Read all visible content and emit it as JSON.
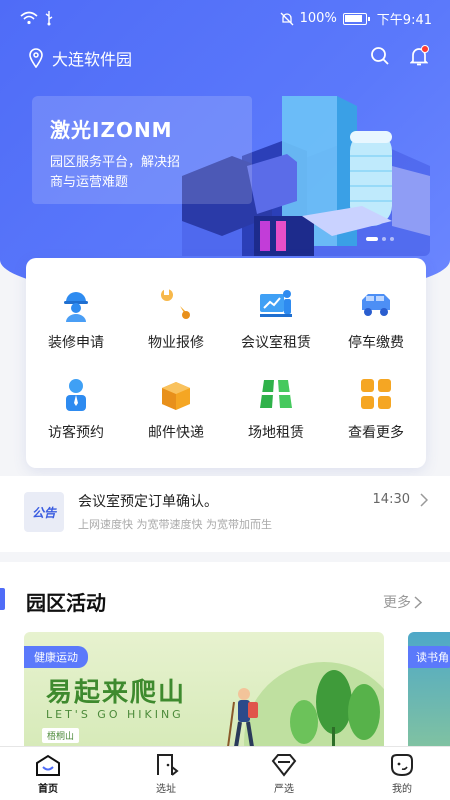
{
  "status_bar": {
    "battery": "100%",
    "time": "下午9:41"
  },
  "header": {
    "location": "大连软件园"
  },
  "banner": {
    "title": "激光IZONM",
    "subtitle": "园区服务平台，解决招商与运营难题"
  },
  "services": [
    {
      "label": "装修申请",
      "icon": "worker-icon"
    },
    {
      "label": "物业报修",
      "icon": "wrench-icon"
    },
    {
      "label": "会议室租赁",
      "icon": "presentation-icon"
    },
    {
      "label": "停车缴费",
      "icon": "car-icon"
    },
    {
      "label": "访客预约",
      "icon": "visitor-icon"
    },
    {
      "label": "邮件快递",
      "icon": "package-icon"
    },
    {
      "label": "场地租赁",
      "icon": "venue-icon"
    },
    {
      "label": "查看更多",
      "icon": "grid-icon"
    }
  ],
  "notice": {
    "badge": "公告",
    "title": "会议室预定订单确认。",
    "time": "14:30",
    "subtitle": "上网速度快 为宽带速度快 为宽带加而生"
  },
  "activities": {
    "title": "园区活动",
    "more": "更多",
    "cards": [
      {
        "tag": "健康运动",
        "headline": "易起来爬山",
        "english": "LET'S GO HIKING",
        "place": "梧桐山"
      },
      {
        "tag": "读书角"
      }
    ]
  },
  "tabs": [
    {
      "label": "首页",
      "active": true
    },
    {
      "label": "选址",
      "active": false
    },
    {
      "label": "严选",
      "active": false
    },
    {
      "label": "我的",
      "active": false
    }
  ],
  "colors": {
    "primary": "#4f6cf7",
    "badge_red": "#ff3b30"
  }
}
